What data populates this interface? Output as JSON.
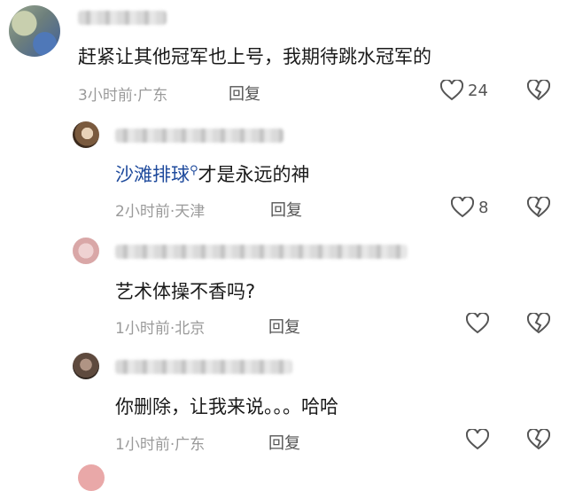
{
  "comments": [
    {
      "text": "赶紧让其他冠军也上号，我期待跳水冠军的",
      "time": "3小时前",
      "location": "广东",
      "reply_label": "回复",
      "like_count": "24"
    },
    {
      "link_text": "沙滩排球",
      "text": "才是永远的神",
      "time": "2小时前",
      "location": "天津",
      "reply_label": "回复",
      "like_count": "8"
    },
    {
      "text": "艺术体操不香吗?",
      "time": "1小时前",
      "location": "北京",
      "reply_label": "回复",
      "like_count": ""
    },
    {
      "text": "你删除，让我来说。。。哈哈",
      "time": "1小时前",
      "location": "广东",
      "reply_label": "回复",
      "like_count": ""
    }
  ],
  "meta_separator": "·",
  "icons": {
    "like": "heart-outline-icon",
    "dislike": "broken-heart-icon",
    "search": "search-icon"
  },
  "colors": {
    "link": "#1e4a9c",
    "meta": "#9a9a9a",
    "text": "#1a1a1a"
  }
}
